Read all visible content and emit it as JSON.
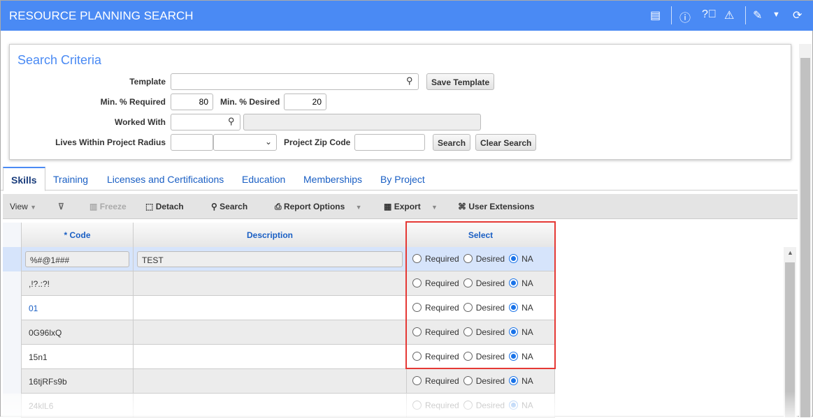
{
  "header": {
    "title": "RESOURCE PLANNING SEARCH",
    "icons": [
      "windows-icon",
      "info-icon",
      "help-icon",
      "warning-icon",
      "edit-note-icon",
      "dropdown-icon",
      "refresh-icon"
    ]
  },
  "search": {
    "title": "Search Criteria",
    "template_label": "Template",
    "template_value": "",
    "save_template": "Save Template",
    "min_required_label": "Min. % Required",
    "min_required": "80",
    "min_desired_label": "Min. % Desired",
    "min_desired": "20",
    "worked_with_label": "Worked With",
    "worked_with": "",
    "worked_with_desc": "",
    "radius_label": "Lives Within Project Radius",
    "radius": "",
    "radius_unit": "",
    "zip_label": "Project Zip Code",
    "zip": "",
    "search_btn": "Search",
    "clear_btn": "Clear Search"
  },
  "tabs": [
    {
      "label": "Skills",
      "active": true
    },
    {
      "label": "Training"
    },
    {
      "label": "Licenses and Certifications"
    },
    {
      "label": "Education"
    },
    {
      "label": "Memberships"
    },
    {
      "label": "By Project"
    }
  ],
  "toolbar": {
    "view": "View",
    "freeze": "Freeze",
    "detach": "Detach",
    "search": "Search",
    "report": "Report Options",
    "export": "Export",
    "ext": "User Extensions"
  },
  "grid": {
    "columns": [
      "* Code",
      "Description",
      "Select"
    ],
    "radio_labels": [
      "Required",
      "Desired",
      "NA"
    ],
    "rows": [
      {
        "code": "%#@1###",
        "description": "TEST",
        "select": "NA"
      },
      {
        "code": ",!?.:?!",
        "description": "",
        "select": "NA"
      },
      {
        "code": "01",
        "description": "",
        "select": "NA"
      },
      {
        "code": "0G96lxQ",
        "description": "",
        "select": "NA"
      },
      {
        "code": "15n1",
        "description": "",
        "select": "NA"
      },
      {
        "code": "16tjRFs9b",
        "description": "",
        "select": "NA"
      },
      {
        "code": "24klL6",
        "description": "",
        "select": "NA"
      }
    ]
  },
  "colors": {
    "accent": "#4a8af4",
    "highlight": "#e53935",
    "selected_row": "#d6e4fb"
  }
}
